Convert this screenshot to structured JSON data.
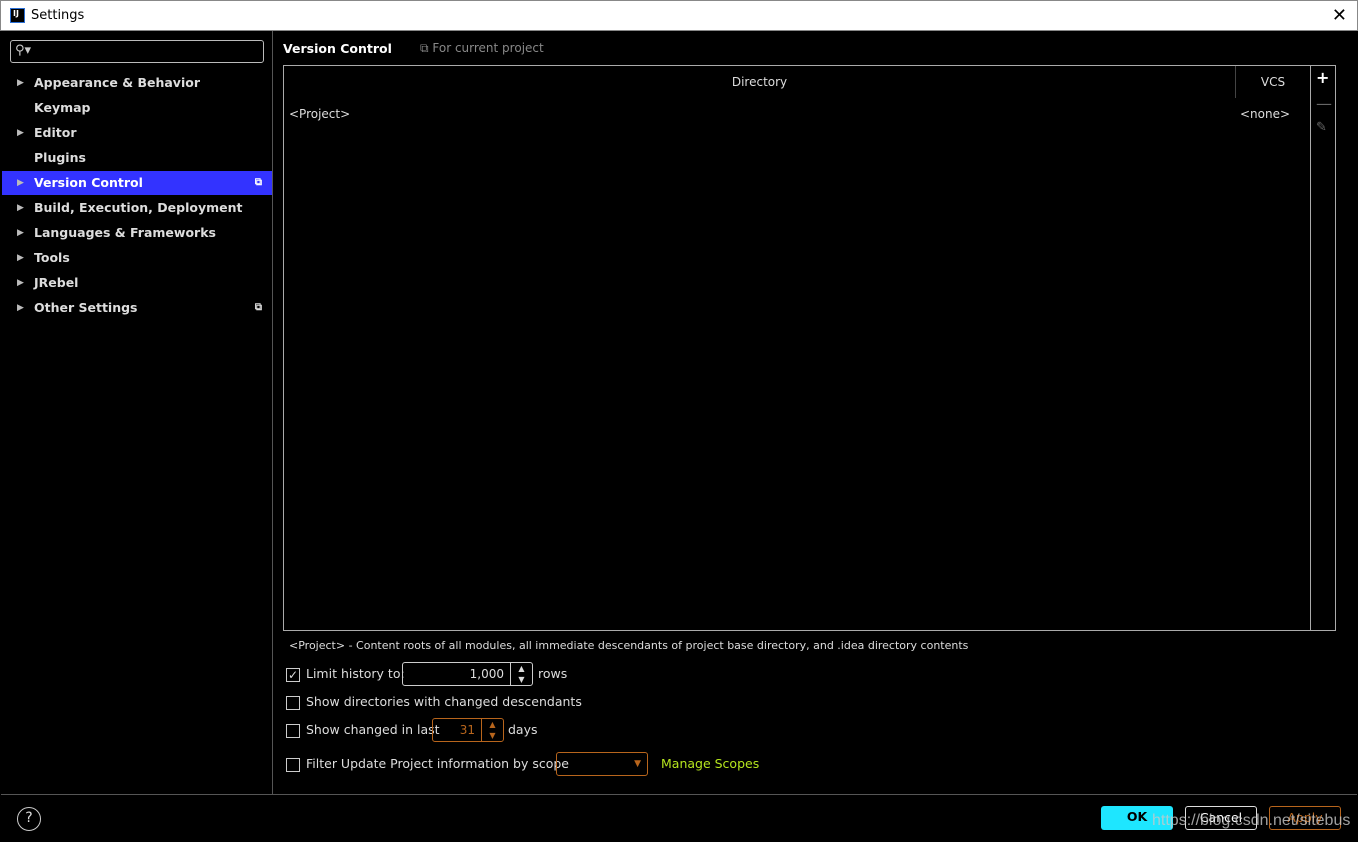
{
  "window": {
    "title": "Settings",
    "icon_text": "IJ",
    "close": "✕"
  },
  "sidebar": {
    "search_placeholder": "",
    "items": [
      {
        "label": "Appearance & Behavior",
        "expandable": true
      },
      {
        "label": "Keymap",
        "expandable": false
      },
      {
        "label": "Editor",
        "expandable": true
      },
      {
        "label": "Plugins",
        "expandable": false
      },
      {
        "label": "Version Control",
        "expandable": true,
        "selected": true,
        "project_icon": true
      },
      {
        "label": "Build, Execution, Deployment",
        "expandable": true
      },
      {
        "label": "Languages & Frameworks",
        "expandable": true
      },
      {
        "label": "Tools",
        "expandable": true
      },
      {
        "label": "JRebel",
        "expandable": true
      },
      {
        "label": "Other Settings",
        "expandable": true,
        "project_icon": true
      }
    ]
  },
  "main": {
    "title": "Version Control",
    "scope": "For current project",
    "table": {
      "columns": [
        "Directory",
        "VCS"
      ],
      "rows": [
        {
          "directory": "<Project>",
          "vcs": "<none>"
        }
      ]
    },
    "note": "<Project> - Content roots of all modules, all immediate descendants of project base directory, and .idea directory contents",
    "limit_history": {
      "label": "Limit history to:",
      "checked": true,
      "value": "1,000",
      "unit": "rows"
    },
    "show_dirs": {
      "label": "Show directories with changed descendants",
      "checked": false
    },
    "show_changed": {
      "label": "Show changed in last",
      "checked": false,
      "value": "31",
      "unit": "days"
    },
    "filter_scope": {
      "label": "Filter Update Project information by scope",
      "checked": false,
      "value": "",
      "link": "Manage Scopes"
    }
  },
  "footer": {
    "help": "?",
    "ok": "OK",
    "cancel": "Cancel",
    "apply": "Apply"
  },
  "watermark": "https://blog.csdn.net/sitebus",
  "colors": {
    "selection": "#3333ff",
    "ok": "#1ee6ff",
    "apply": "#b8651c",
    "link": "#b6e61e",
    "spinner_disabled": "#b8651c"
  }
}
